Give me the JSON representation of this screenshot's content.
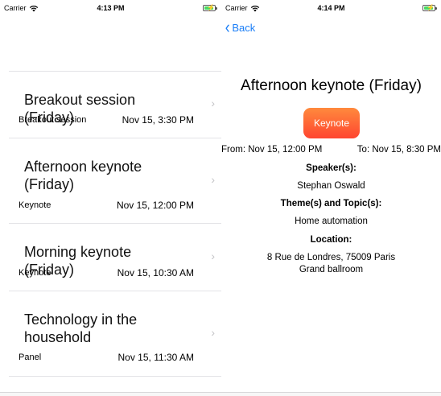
{
  "left_screen": {
    "status": {
      "carrier": "Carrier",
      "time": "4:13 PM",
      "battery_level": 0.8
    },
    "sessions": [
      {
        "title": "Breakout session (Friday)",
        "type": "Breakout session",
        "datetime": "Nov 15, 3:30 PM"
      },
      {
        "title": "Afternoon keynote (Friday)",
        "type": "Keynote",
        "datetime": "Nov 15, 12:00 PM"
      },
      {
        "title": "Morning keynote (Friday)",
        "type": "Keynote",
        "datetime": "Nov 15, 10:30 AM"
      },
      {
        "title": "Technology in the household",
        "type": "Panel",
        "datetime": "Nov 15, 11:30 AM"
      }
    ]
  },
  "right_screen": {
    "status": {
      "carrier": "Carrier",
      "time": "4:14 PM",
      "battery_level": 0.8
    },
    "nav": {
      "back_label": "Back"
    },
    "detail": {
      "title": "Afternoon keynote (Friday)",
      "type_button": "Keynote",
      "from": "From: Nov 15, 12:00 PM",
      "to": "To: Nov 15, 8:30 PM",
      "speaker_label": "Speaker(s):",
      "speaker": "Stephan Oswald",
      "theme_label": "Theme(s) and Topic(s):",
      "theme": "Home automation",
      "location_label": "Location:",
      "address": "8 Rue de Londres, 75009 Paris",
      "room": "Grand ballroom"
    }
  },
  "colors": {
    "accent": "#1a7ef7",
    "button_top": "#ff8a3d",
    "button_bottom": "#ff4530",
    "battery": "#4cd964"
  }
}
